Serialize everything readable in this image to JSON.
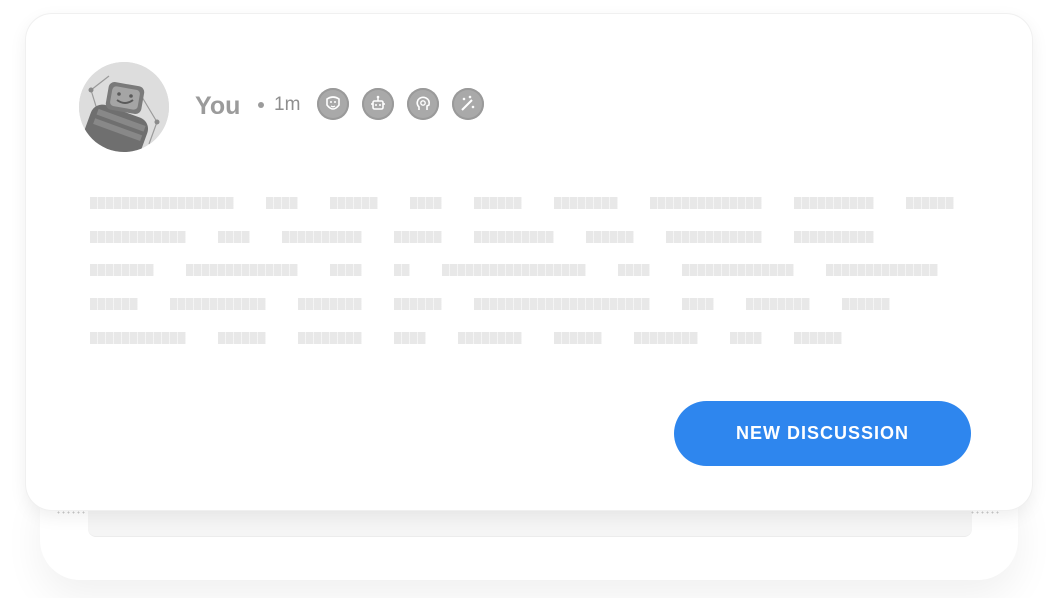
{
  "post": {
    "author": "You",
    "time": "1m",
    "badges": [
      {
        "icon": "mask-badge-icon"
      },
      {
        "icon": "robot-badge-icon"
      },
      {
        "icon": "bulb-head-badge-icon"
      },
      {
        "icon": "magic-wand-badge-icon"
      }
    ]
  },
  "actions": {
    "new_discussion_label": "NEW DISCUSSION"
  },
  "colors": {
    "accent": "#2e86ee",
    "muted_text": "#9b9b9b",
    "placeholder": "#e8e8e8"
  }
}
